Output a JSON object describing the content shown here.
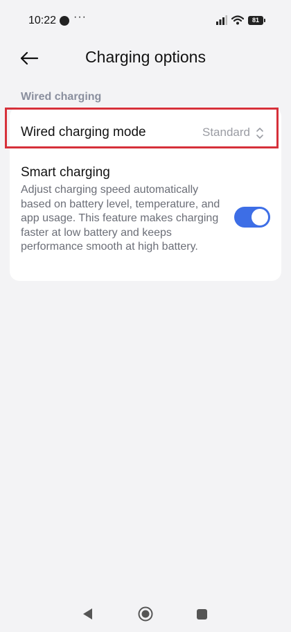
{
  "status_bar": {
    "time": "10:22",
    "more": "···",
    "battery": "81",
    "icons": [
      "dot-icon",
      "signal-icon",
      "wifi-icon",
      "battery-icon"
    ]
  },
  "header": {
    "title": "Charging options",
    "back_icon": "back-arrow-icon"
  },
  "section": {
    "title": "Wired charging"
  },
  "wired_mode": {
    "label": "Wired charging mode",
    "value": "Standard",
    "icon": "chevron-updown-icon"
  },
  "smart_charging": {
    "title": "Smart charging",
    "description": "Adjust charging speed automatically based on battery level, temperature, and app usage. This feature makes charging faster at low battery and keeps performance smooth at high battery.",
    "enabled": true
  },
  "nav_bar": {
    "icons": [
      "nav-back-icon",
      "nav-home-icon",
      "nav-recents-icon"
    ]
  },
  "colors": {
    "accent": "#3d6ee6",
    "highlight": "#d6303a",
    "section_title": "#8a8f9e",
    "background": "#f3f3f5"
  }
}
